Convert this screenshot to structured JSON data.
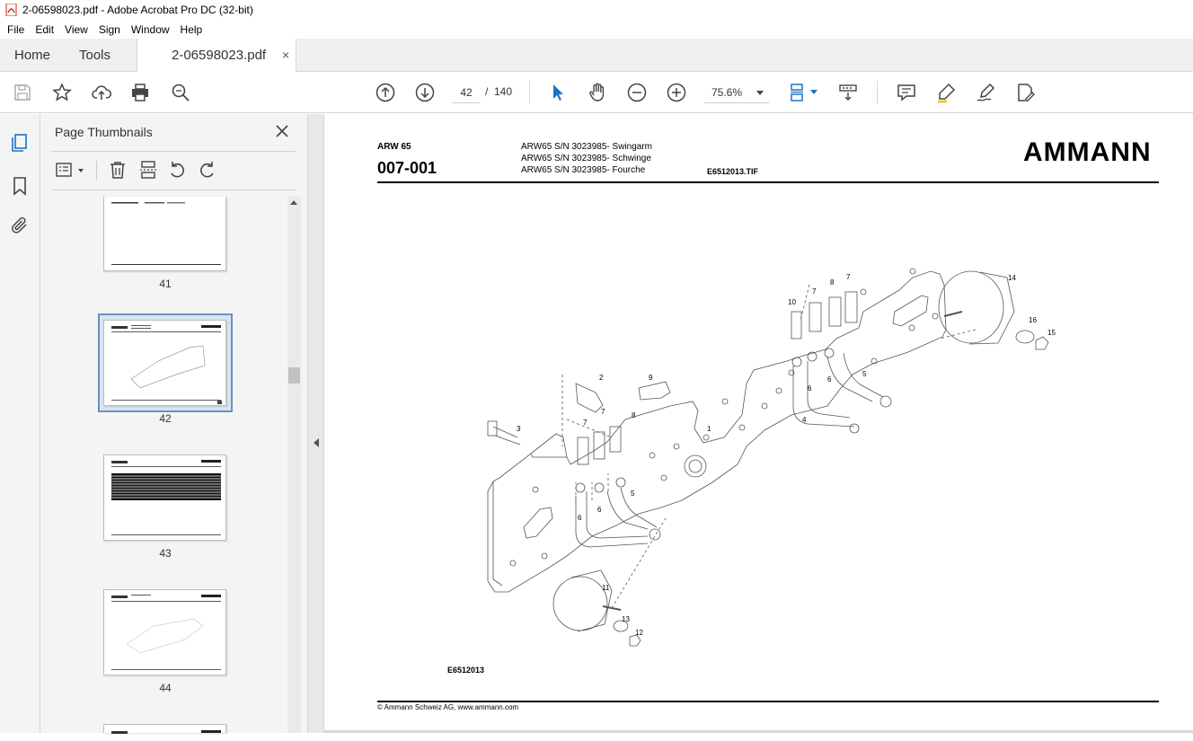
{
  "window": {
    "title": "2-06598023.pdf - Adobe Acrobat Pro DC (32-bit)"
  },
  "menu": [
    "File",
    "Edit",
    "View",
    "Sign",
    "Window",
    "Help"
  ],
  "tabs": {
    "home": "Home",
    "tools": "Tools",
    "document": "2-06598023.pdf",
    "close": "×"
  },
  "toolbar": {
    "page_current": "42",
    "page_sep": "/",
    "page_total": "140",
    "zoom": "75.6%"
  },
  "panel": {
    "title": "Page Thumbnails",
    "thumbnails": [
      {
        "label": "41"
      },
      {
        "label": "42",
        "selected": true
      },
      {
        "label": "43"
      },
      {
        "label": "44"
      }
    ]
  },
  "document": {
    "model": "ARW 65",
    "code": "007-001",
    "descriptions": [
      "ARW65 S/N 3023985- Swingarm",
      "ARW65 S/N 3023985- Schwinge",
      "ARW65 S/N 3023985- Fourche"
    ],
    "tif": "E6512013.TIF",
    "logo": "AMMANN",
    "figure_label": "E6512013",
    "footer": "© Ammann Schweiz AG, www.ammann.com",
    "callouts": [
      "1",
      "2",
      "3",
      "4",
      "5",
      "5",
      "6",
      "6",
      "6",
      "6",
      "7",
      "7",
      "7",
      "7",
      "8",
      "8",
      "9",
      "10",
      "11",
      "12",
      "13",
      "14",
      "15",
      "16"
    ]
  }
}
